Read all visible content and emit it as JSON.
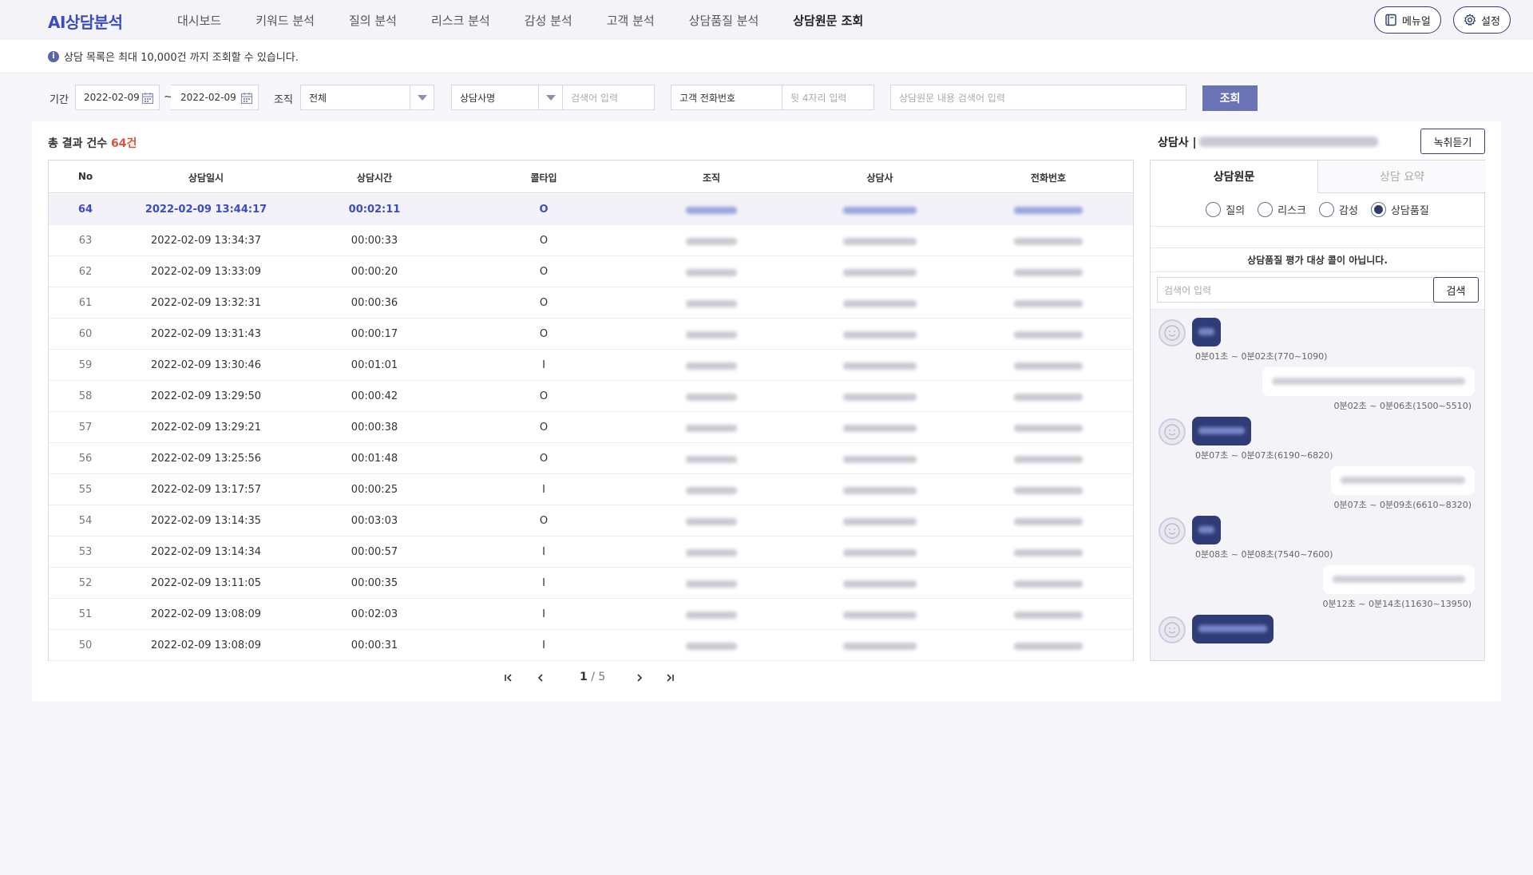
{
  "header": {
    "logo": "AI상담분석",
    "nav": [
      "대시보드",
      "키워드 분석",
      "질의 분석",
      "리스크 분석",
      "감성 분석",
      "고객 분석",
      "상담품질 분석",
      "상담원문 조회"
    ],
    "active_nav_index": 7,
    "manual_label": "메뉴얼",
    "settings_label": "설정"
  },
  "notice": {
    "icon": "info-icon",
    "text": "상담 목록은 최대 10,000건 까지 조회할 수 있습니다."
  },
  "filters": {
    "period_label": "기간",
    "date_from": "2022-02-09",
    "date_sep": "~",
    "date_to": "2022-02-09",
    "org_label": "조직",
    "org_value": "전체",
    "agent_type": "상담사명",
    "agent_placeholder": "검색어 입력",
    "phone_label": "고객 전화번호",
    "phone_placeholder": "뒷 4자리 입력",
    "content_placeholder": "상담원문 내용 검색어 입력",
    "search_label": "조회"
  },
  "results": {
    "label": "총 결과 건수",
    "count": "64건"
  },
  "table": {
    "columns": [
      "No",
      "상담일시",
      "상담시간",
      "콜타입",
      "조직",
      "상담사",
      "전화번호"
    ],
    "selected_index": 0,
    "rows": [
      {
        "no": "64",
        "datetime": "2022-02-09 13:44:17",
        "duration": "00:02:11",
        "calltype": "O"
      },
      {
        "no": "63",
        "datetime": "2022-02-09 13:34:37",
        "duration": "00:00:33",
        "calltype": "O"
      },
      {
        "no": "62",
        "datetime": "2022-02-09 13:33:09",
        "duration": "00:00:20",
        "calltype": "O"
      },
      {
        "no": "61",
        "datetime": "2022-02-09 13:32:31",
        "duration": "00:00:36",
        "calltype": "O"
      },
      {
        "no": "60",
        "datetime": "2022-02-09 13:31:43",
        "duration": "00:00:17",
        "calltype": "O"
      },
      {
        "no": "59",
        "datetime": "2022-02-09 13:30:46",
        "duration": "00:01:01",
        "calltype": "I"
      },
      {
        "no": "58",
        "datetime": "2022-02-09 13:29:50",
        "duration": "00:00:42",
        "calltype": "O"
      },
      {
        "no": "57",
        "datetime": "2022-02-09 13:29:21",
        "duration": "00:00:38",
        "calltype": "O"
      },
      {
        "no": "56",
        "datetime": "2022-02-09 13:25:56",
        "duration": "00:01:48",
        "calltype": "O"
      },
      {
        "no": "55",
        "datetime": "2022-02-09 13:17:57",
        "duration": "00:00:25",
        "calltype": "I"
      },
      {
        "no": "54",
        "datetime": "2022-02-09 13:14:35",
        "duration": "00:03:03",
        "calltype": "O"
      },
      {
        "no": "53",
        "datetime": "2022-02-09 13:14:34",
        "duration": "00:00:57",
        "calltype": "I"
      },
      {
        "no": "52",
        "datetime": "2022-02-09 13:11:05",
        "duration": "00:00:35",
        "calltype": "I"
      },
      {
        "no": "51",
        "datetime": "2022-02-09 13:08:09",
        "duration": "00:02:03",
        "calltype": "I"
      },
      {
        "no": "50",
        "datetime": "2022-02-09 13:08:09",
        "duration": "00:00:31",
        "calltype": "I"
      }
    ]
  },
  "pagination": {
    "current": "1",
    "total": "5",
    "sep": "/"
  },
  "detail": {
    "title": "상담사 |",
    "record_label": "녹취듣기",
    "tabs": [
      "상담원문",
      "상담 요약"
    ],
    "radios": [
      "질의",
      "리스크",
      "감성",
      "상담품질"
    ],
    "selected_radio": 3,
    "quality_message": "상담품질 평가 대상 콜이 아닙니다.",
    "keyword_placeholder": "검색어 입력",
    "keyword_button": "검색",
    "messages": [
      {
        "side": "left",
        "time": "0분01초 ~ 0분02초(770~1090)"
      },
      {
        "side": "right",
        "time": "0분02초 ~ 0분06초(1500~5510)"
      },
      {
        "side": "left",
        "time": "0분07초 ~ 0분07초(6190~6820)"
      },
      {
        "side": "right",
        "time": "0분07초 ~ 0분09초(6610~8320)"
      },
      {
        "side": "left",
        "time": "0분08초 ~ 0분08초(7540~7600)"
      },
      {
        "side": "right",
        "time": "0분12초 ~ 0분14초(11630~13950)"
      },
      {
        "side": "left",
        "time": ""
      }
    ]
  },
  "colors": {
    "accent": "#3b4cc0",
    "button": "#6a74b4",
    "count": "#e0503a",
    "bubble": "#2f3c78"
  }
}
